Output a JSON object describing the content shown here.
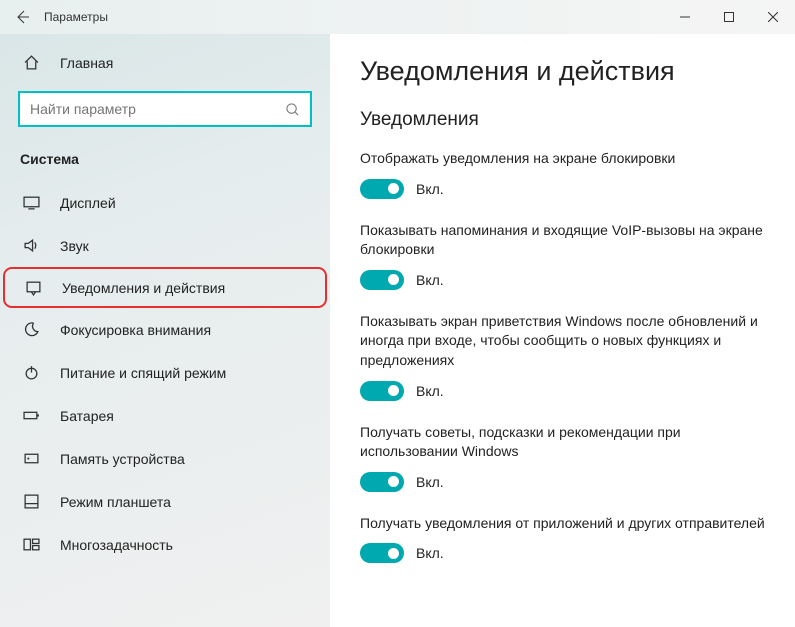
{
  "window": {
    "title": "Параметры"
  },
  "sidebar": {
    "home": "Главная",
    "search_placeholder": "Найти параметр",
    "section": "Система",
    "items": [
      {
        "label": "Дисплей"
      },
      {
        "label": "Звук"
      },
      {
        "label": "Уведомления и действия"
      },
      {
        "label": "Фокусировка внимания"
      },
      {
        "label": "Питание и спящий режим"
      },
      {
        "label": "Батарея"
      },
      {
        "label": "Память устройства"
      },
      {
        "label": "Режим планшета"
      },
      {
        "label": "Многозадачность"
      }
    ]
  },
  "content": {
    "title": "Уведомления и действия",
    "subtitle": "Уведомления",
    "on_label": "Вкл.",
    "settings": [
      {
        "label": "Отображать уведомления на экране блокировки"
      },
      {
        "label": "Показывать напоминания и входящие VoIP-вызовы на экране блокировки"
      },
      {
        "label": "Показывать экран приветствия Windows после обновлений и иногда при входе, чтобы сообщить о новых функциях и предложениях"
      },
      {
        "label": "Получать советы, подсказки и рекомендации при использовании Windows"
      },
      {
        "label": "Получать уведомления от приложений и других отправителей"
      }
    ]
  }
}
